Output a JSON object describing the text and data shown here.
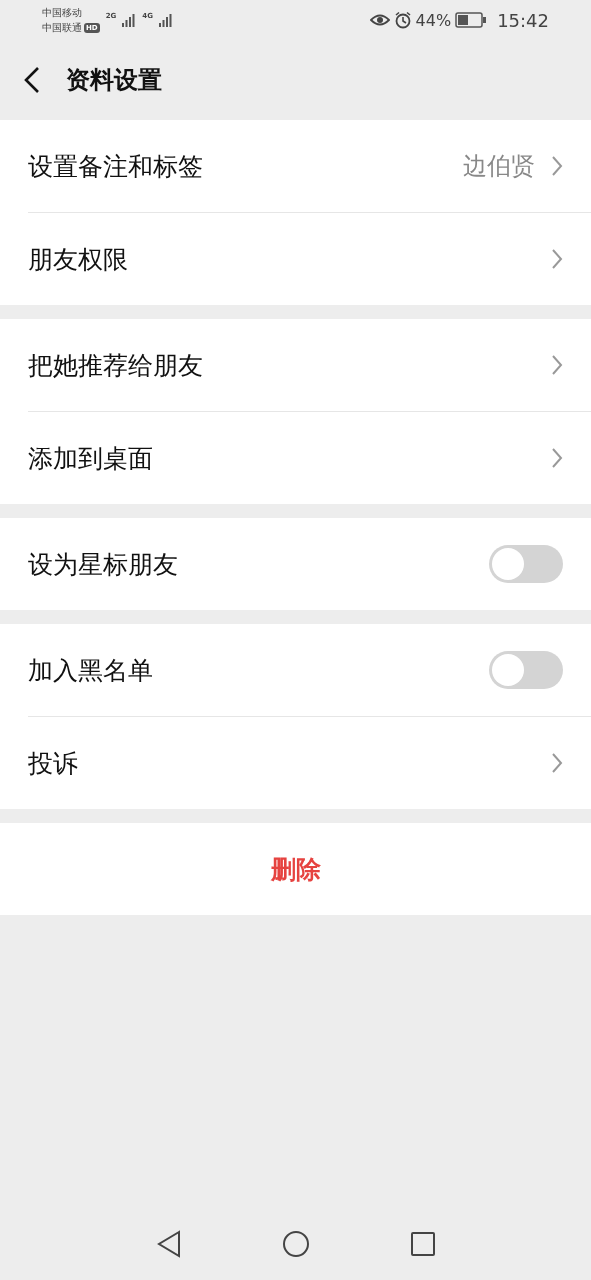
{
  "status_bar": {
    "carrier_1": "中国移动",
    "carrier_2": "中国联通",
    "hd_badge": "HD",
    "network_1": "2G",
    "network_2": "4G",
    "battery_percent": "44%",
    "time": "15:42"
  },
  "header": {
    "title": "资料设置"
  },
  "groups": [
    {
      "rows": [
        {
          "kind": "link",
          "label": "设置备注和标签",
          "value": "边伯贤"
        },
        {
          "kind": "link",
          "label": "朋友权限"
        }
      ]
    },
    {
      "rows": [
        {
          "kind": "link",
          "label": "把她推荐给朋友"
        },
        {
          "kind": "link",
          "label": "添加到桌面"
        }
      ]
    },
    {
      "rows": [
        {
          "kind": "toggle",
          "label": "设为星标朋友",
          "on": false
        }
      ]
    },
    {
      "rows": [
        {
          "kind": "toggle",
          "label": "加入黑名单",
          "on": false
        },
        {
          "kind": "link",
          "label": "投诉"
        }
      ]
    }
  ],
  "delete_button": "删除"
}
